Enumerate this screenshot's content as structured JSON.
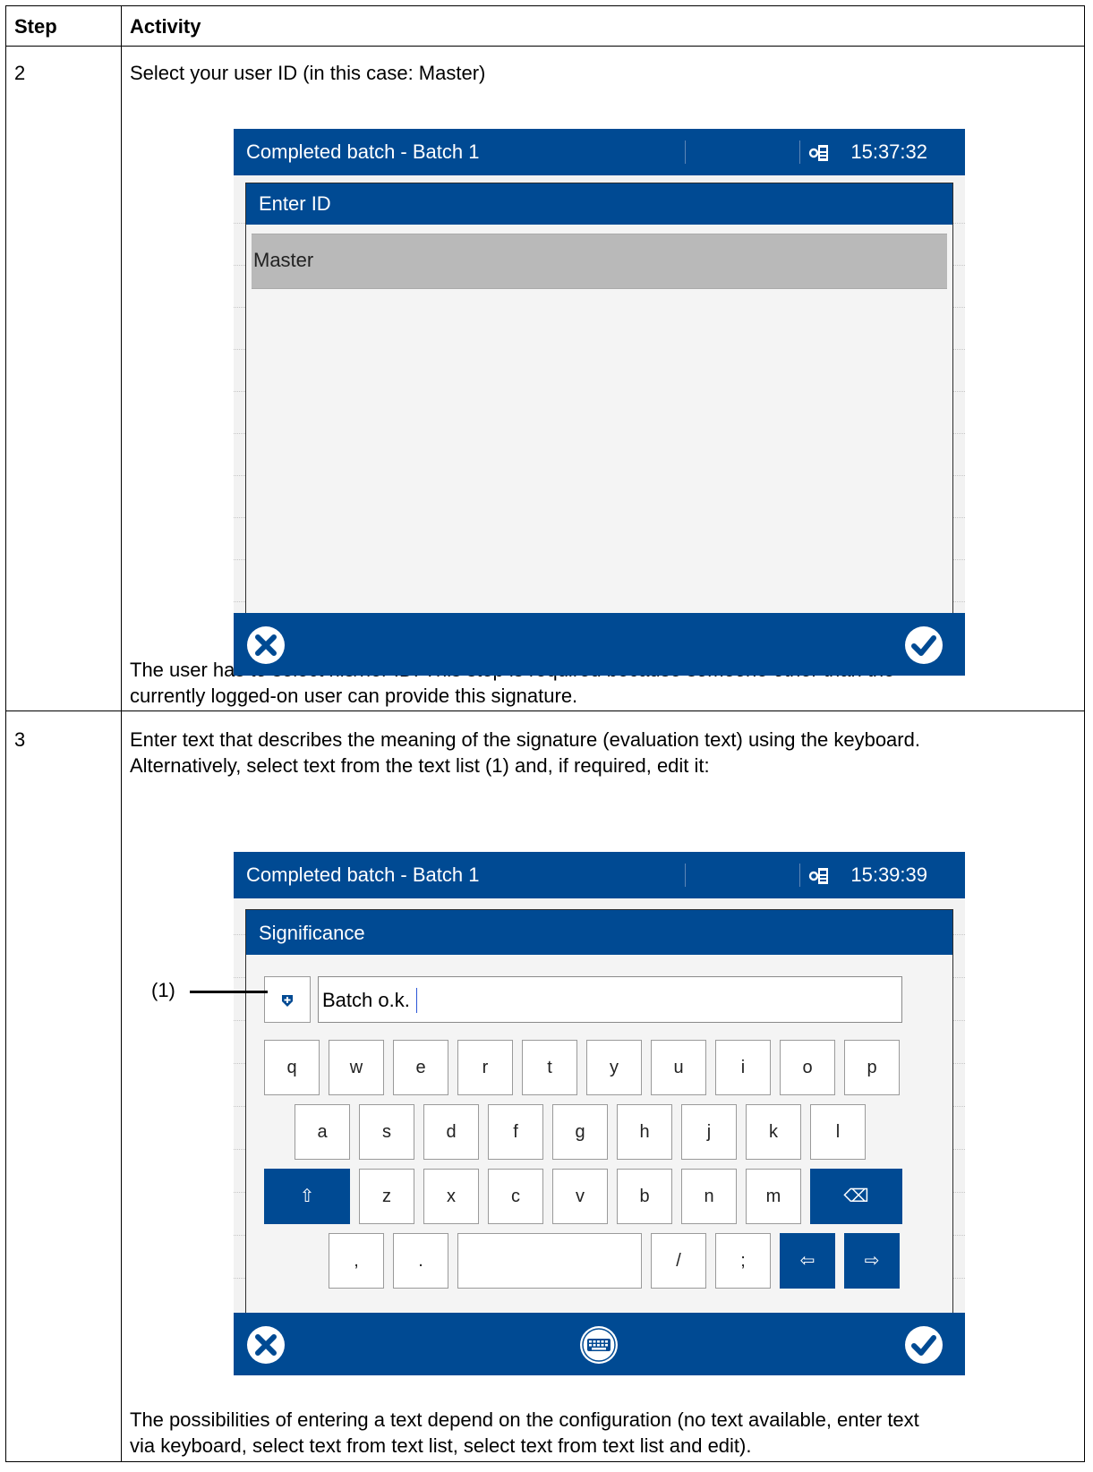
{
  "table": {
    "col_step": "Step",
    "col_activity": "Activity",
    "rows": [
      {
        "step": "2",
        "instruction": "Select your user ID (in this case: Master)",
        "note_line1": "The user has to select his/her ID. This step is required because someone other than the",
        "note_line2": "currently logged-on user can provide this signature."
      },
      {
        "step": "3",
        "instruction_line1": "Enter text that describes the meaning of the signature (evaluation text) using the keyboard.",
        "instruction_line2": "Alternatively, select text from the text list (1) and, if required, edit it:",
        "note_line1": "The possibilities of entering a text depend on the configuration (no text available, enter text",
        "note_line2": "via keyboard, select text from text list, select text from text list and edit)."
      }
    ]
  },
  "screen1": {
    "title": "Completed batch - Batch 1",
    "time": "15:37:32",
    "dialog_title": "Enter ID",
    "selected_item": "Master"
  },
  "screen2": {
    "title": "Completed batch - Batch 1",
    "time": "15:39:39",
    "dialog_title": "Significance",
    "callout": "(1)",
    "input_value": "Batch o.k.",
    "keys_row1": [
      "q",
      "w",
      "e",
      "r",
      "t",
      "y",
      "u",
      "i",
      "o",
      "p"
    ],
    "keys_row2": [
      "a",
      "s",
      "d",
      "f",
      "g",
      "h",
      "j",
      "k",
      "l"
    ],
    "keys_row3": [
      "z",
      "x",
      "c",
      "v",
      "b",
      "n",
      "m"
    ],
    "keys_row4": [
      ",",
      ".",
      "",
      "/",
      ";"
    ],
    "shift_key": "⇧",
    "backspace_key": "⌫",
    "left_key": "⇦",
    "right_key": "⇨"
  },
  "colors": {
    "brand_blue": "#004a93",
    "screen_bg": "#f2f2f2",
    "selected": "#b9b9b9"
  },
  "icons": [
    "key-icon",
    "cancel-icon",
    "confirm-icon",
    "keyboard-icon",
    "text-list-icon"
  ]
}
